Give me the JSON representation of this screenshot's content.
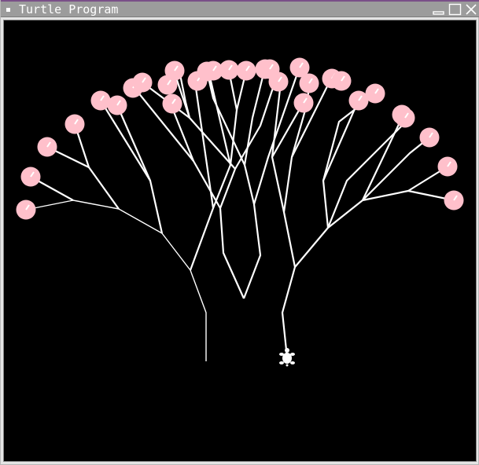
{
  "window": {
    "title": "Turtle Program"
  },
  "titlebar_buttons": [
    {
      "name": "minimize-button",
      "icon": "minimize-icon"
    },
    {
      "name": "maximize-button",
      "icon": "maximize-icon"
    },
    {
      "name": "close-button",
      "icon": "close-icon"
    }
  ],
  "canvas": {
    "background": "#000000",
    "line_color": "#ffffff",
    "blossom_color": "#ffc0cb",
    "turtle_icon": "turtle-icon"
  }
}
